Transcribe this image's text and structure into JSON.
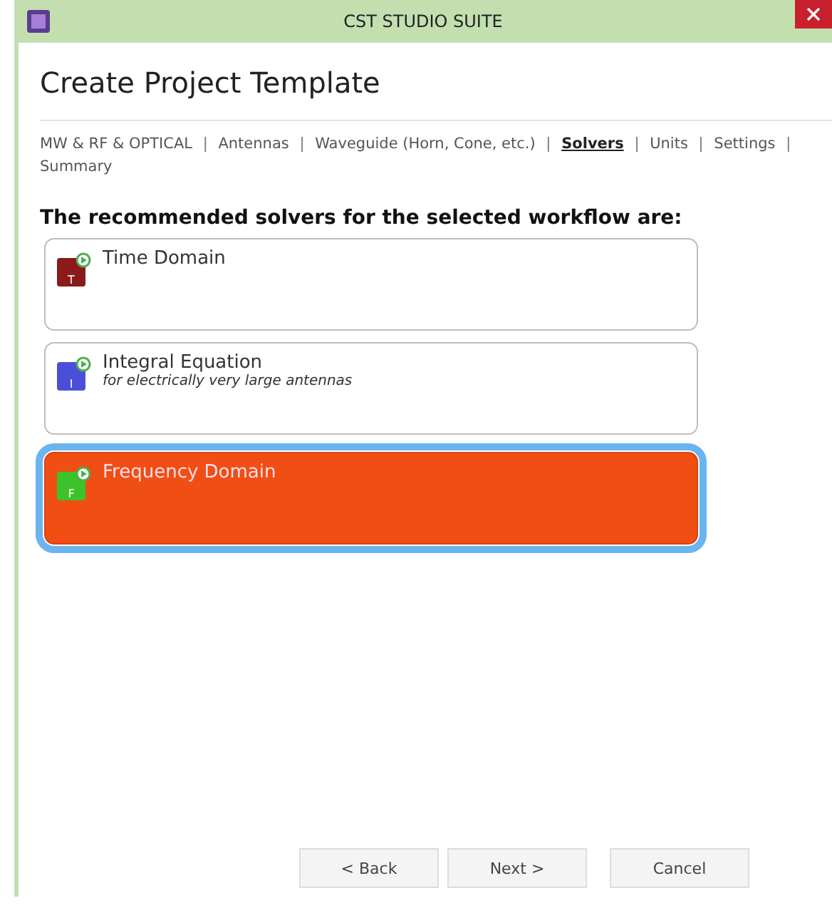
{
  "window": {
    "title": "CST STUDIO SUITE"
  },
  "page_title": "Create Project Template",
  "breadcrumb": {
    "separator": "|",
    "steps": [
      {
        "label": "MW & RF & OPTICAL",
        "selected": false
      },
      {
        "label": "Antennas",
        "selected": false
      },
      {
        "label": "Waveguide (Horn, Cone, etc.)",
        "selected": false
      },
      {
        "label": "Solvers",
        "selected": true
      },
      {
        "label": "Units",
        "selected": false
      },
      {
        "label": "Settings",
        "selected": false
      },
      {
        "label": "Summary",
        "selected": false
      }
    ]
  },
  "heading": "The recommended solvers for the selected workflow are:",
  "solvers": [
    {
      "name": "Time Domain",
      "icon_letter": "T",
      "color": "#8b1a1a",
      "selected": false
    },
    {
      "name": "Integral Equation",
      "description": "for electrically very large antennas",
      "icon_letter": "I",
      "color": "#4b4fd8",
      "selected": false
    },
    {
      "name": "Frequency Domain",
      "icon_letter": "F",
      "color": "#3cc22a",
      "selected": true
    }
  ],
  "buttons": [
    "< Back",
    "Next >",
    "Cancel"
  ]
}
